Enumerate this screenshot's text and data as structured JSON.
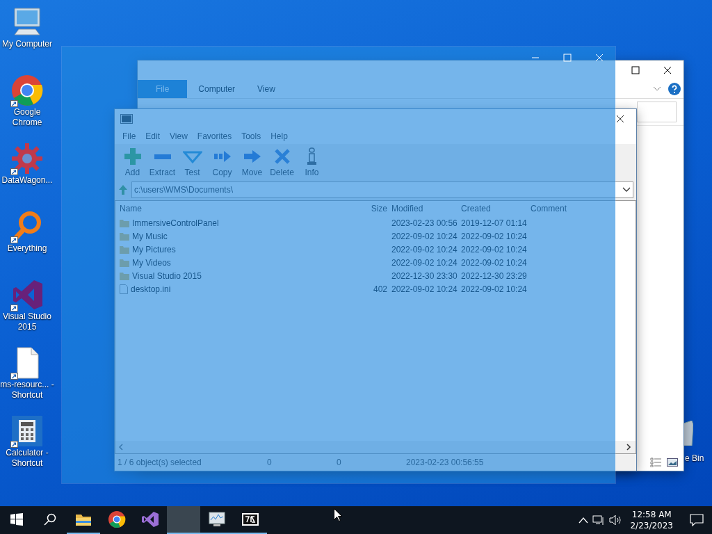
{
  "desktop_icons": [
    {
      "label": "My Computer",
      "kind": "computer",
      "shortcut": false
    },
    {
      "label": "Google Chrome",
      "kind": "chrome",
      "shortcut": true
    },
    {
      "label": "DataWagon...",
      "kind": "gear",
      "shortcut": true
    },
    {
      "label": "Everything",
      "kind": "magnifier",
      "shortcut": true
    },
    {
      "label": "Visual Studio 2015",
      "kind": "studio",
      "shortcut": true
    },
    {
      "label": "ms-resourc... - Shortcut",
      "kind": "file",
      "shortcut": true
    },
    {
      "label": "Calculator - Shortcut",
      "kind": "calculator",
      "shortcut": true
    }
  ],
  "recycle_bin": {
    "label": "e Bin"
  },
  "explorer_window": {
    "ribbon_tabs": [
      {
        "label": "File",
        "kind": "file"
      },
      {
        "label": "Computer",
        "kind": "tab"
      },
      {
        "label": "View",
        "kind": "tab"
      }
    ]
  },
  "archiver_window": {
    "menu": [
      "File",
      "Edit",
      "View",
      "Favorites",
      "Tools",
      "Help"
    ],
    "toolbar": [
      {
        "label": "Add",
        "kind": "add"
      },
      {
        "label": "Extract",
        "kind": "extract"
      },
      {
        "label": "Test",
        "kind": "test"
      },
      {
        "label": "Copy",
        "kind": "copy"
      },
      {
        "label": "Move",
        "kind": "move"
      },
      {
        "label": "Delete",
        "kind": "delete"
      },
      {
        "label": "Info",
        "kind": "info"
      }
    ],
    "address": "c:\\users\\WMS\\Documents\\",
    "columns": [
      "Name",
      "Size",
      "Modified",
      "Created",
      "Comment"
    ],
    "rows": [
      {
        "kind": "folder",
        "name": "ImmersiveControlPanel",
        "modified": "2023-02-23 00:56",
        "created": "2019-12-07 01:14"
      },
      {
        "kind": "folder",
        "name": "My Music",
        "modified": "2022-09-02 10:24",
        "created": "2022-09-02 10:24"
      },
      {
        "kind": "folder",
        "name": "My Pictures",
        "modified": "2022-09-02 10:24",
        "created": "2022-09-02 10:24"
      },
      {
        "kind": "folder",
        "name": "My Videos",
        "modified": "2022-09-02 10:24",
        "created": "2022-09-02 10:24"
      },
      {
        "kind": "folder",
        "name": "Visual Studio 2015",
        "modified": "2022-12-30 23:30",
        "created": "2022-12-30 23:29"
      },
      {
        "kind": "file",
        "name": "desktop.ini",
        "size": "402",
        "modified": "2022-09-02 10:24",
        "created": "2022-09-02 10:24"
      }
    ],
    "status": [
      "1 / 6 object(s) selected",
      "0",
      "0",
      "2023-02-23 00:56:55"
    ]
  },
  "taskbar": {
    "apps": [
      {
        "kind": "explorer",
        "running": true,
        "active": false
      },
      {
        "kind": "chrome",
        "running": false,
        "active": false
      },
      {
        "kind": "studio",
        "running": false,
        "active": false
      },
      {
        "kind": "blank",
        "running": true,
        "active": true
      },
      {
        "kind": "monitor",
        "running": true,
        "active": false
      },
      {
        "kind": "sevenzip",
        "running": true,
        "active": false
      }
    ],
    "time": "12:58 AM",
    "date": "2/23/2023"
  }
}
